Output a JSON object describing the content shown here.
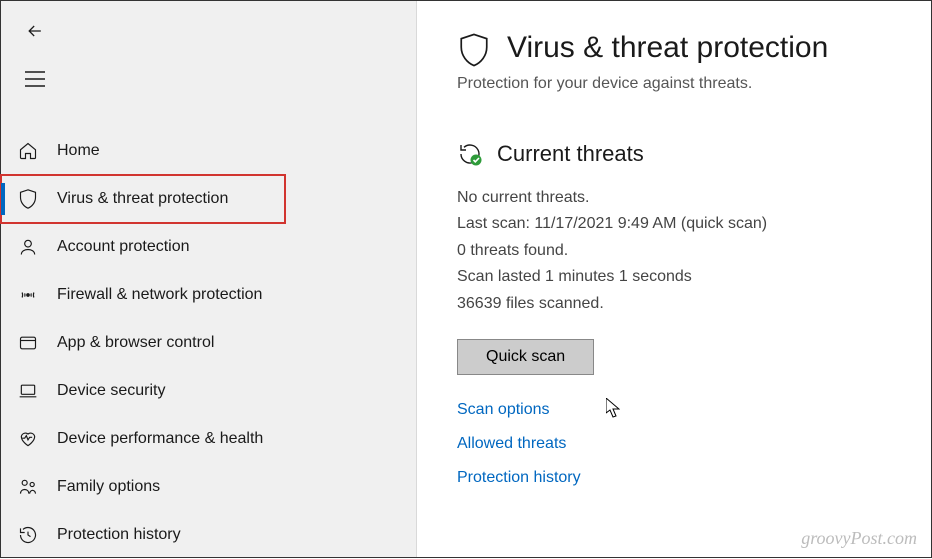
{
  "sidebar": {
    "items": [
      {
        "label": "Home"
      },
      {
        "label": "Virus & threat protection"
      },
      {
        "label": "Account protection"
      },
      {
        "label": "Firewall & network protection"
      },
      {
        "label": "App & browser control"
      },
      {
        "label": "Device security"
      },
      {
        "label": "Device performance & health"
      },
      {
        "label": "Family options"
      },
      {
        "label": "Protection history"
      }
    ]
  },
  "page": {
    "title": "Virus & threat protection",
    "subtitle": "Protection for your device against threats."
  },
  "threats": {
    "section_title": "Current threats",
    "status": "No current threats.",
    "last_scan": "Last scan: 11/17/2021 9:49 AM (quick scan)",
    "found": "0 threats found.",
    "duration": "Scan lasted 1 minutes 1 seconds",
    "files": "36639 files scanned.",
    "button": "Quick scan",
    "links": {
      "scan_options": "Scan options",
      "allowed": "Allowed threats",
      "history": "Protection history"
    }
  },
  "watermark": "groovyPost.com"
}
